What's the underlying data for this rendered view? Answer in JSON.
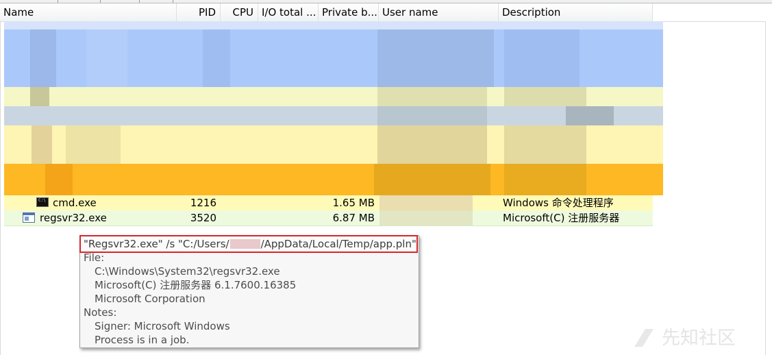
{
  "table": {
    "columns": [
      "Name",
      "PID",
      "CPU",
      "I/O total ...",
      "Private b...",
      "User name",
      "Description"
    ],
    "rows": [
      {
        "icon": "console-icon",
        "name": "cmd.exe",
        "pid": "1216",
        "private_bytes": "1.65 MB",
        "description": "Windows 命令处理程序",
        "bg": "#fffab8"
      },
      {
        "icon": "window-app-icon",
        "name": "regsvr32.exe",
        "pid": "3520",
        "private_bytes": "6.87 MB",
        "description": "Microsoft(C) 注册服务器",
        "bg": "#eefade"
      }
    ]
  },
  "tooltip": {
    "command_prefix": "\"Regsvr32.exe\" /s \"C:/Users/",
    "command_suffix": "/AppData/Local/Temp/app.pln\"",
    "file_label": "File:",
    "file_path": "C:\\Windows\\System32\\regsvr32.exe",
    "file_desc": "Microsoft(C) 注册服务器 6.1.7600.16385",
    "file_company": "Microsoft Corporation",
    "notes_label": "Notes:",
    "signer": "Signer: Microsoft Windows",
    "job": "Process is in a job."
  },
  "watermark": "先知社区",
  "colors": {
    "highlight_border": "#d6262b",
    "redaction": "#e8c9cc",
    "services_blue": "#aac8fa",
    "own_process_yellow": "#fffab8",
    "job_orange": "#fdb824"
  }
}
